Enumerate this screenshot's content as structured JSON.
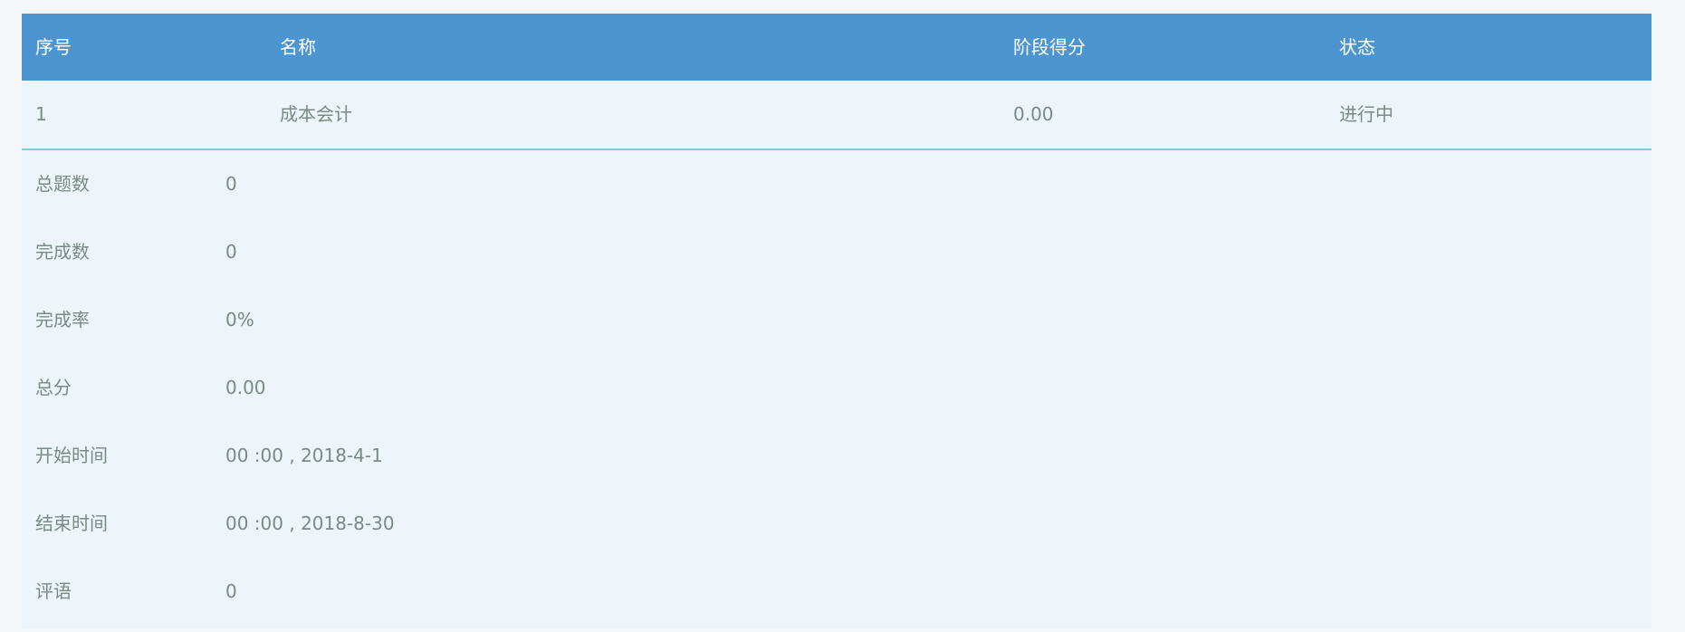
{
  "header": {
    "index": "序号",
    "name": "名称",
    "stage_score": "阶段得分",
    "status": "状态"
  },
  "row": {
    "index": "1",
    "name": "成本会计",
    "stage_score": "0.00",
    "status": "进行中"
  },
  "details": [
    {
      "label": "总题数",
      "value": "0"
    },
    {
      "label": "完成数",
      "value": "0"
    },
    {
      "label": "完成率",
      "value": "0%"
    },
    {
      "label": "总分",
      "value": "0.00"
    },
    {
      "label": "开始时间",
      "value": "00 :00 , 2018-4-1"
    },
    {
      "label": "结束时间",
      "value": "00 :00 , 2018-8-30"
    },
    {
      "label": "评语",
      "value": "0"
    }
  ]
}
